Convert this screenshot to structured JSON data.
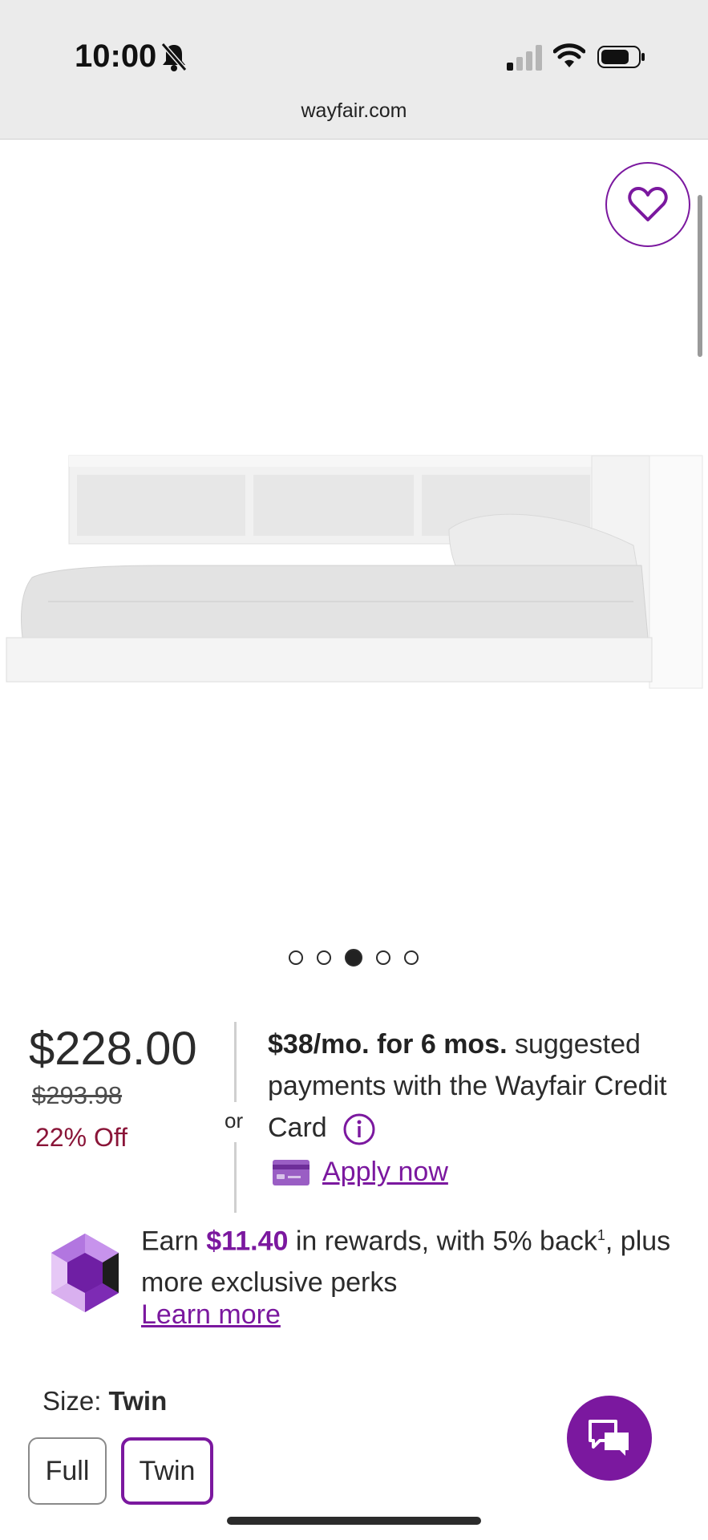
{
  "status_bar": {
    "time": "10:00",
    "icons": [
      "bell-slash-icon",
      "signal-icon",
      "wifi-icon",
      "battery-icon"
    ]
  },
  "browser": {
    "url": "wayfair.com"
  },
  "gallery": {
    "image_count": 5,
    "active_index": 2,
    "favorite_icon": "heart-icon"
  },
  "pricing": {
    "price": "$228.00",
    "original_price": "$293.98",
    "discount": "22% Off",
    "or_text": "or",
    "finance_bold": "$38/mo. for 6 mos.",
    "finance_text": " suggested payments with the Wayfair Credit Card",
    "apply_label": "Apply now"
  },
  "rewards": {
    "earn_prefix": "Earn ",
    "amount": "$11.40",
    "text_mid": " in rewards, with 5% back",
    "footnote": "1",
    "text_end": ", plus more exclusive perks",
    "learn_more": "Learn more"
  },
  "size": {
    "label": "Size: ",
    "selected": "Twin",
    "options": [
      "Full",
      "Twin"
    ]
  },
  "colors": {
    "brand_purple": "#7b189f",
    "discount_red": "#8a1538"
  }
}
